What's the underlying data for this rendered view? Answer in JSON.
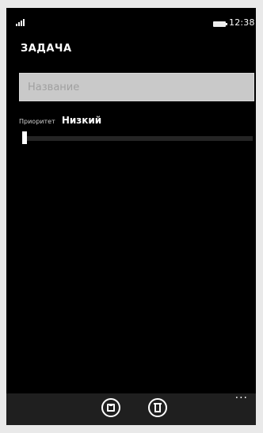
{
  "status_bar": {
    "time": "12:38",
    "signal_icon": "signal-icon",
    "battery_icon": "battery-icon"
  },
  "page": {
    "title": "ЗАДАЧА"
  },
  "form": {
    "name_value": "",
    "name_placeholder": "Название",
    "priority_label": "Приоритет",
    "priority_value": "Низкий",
    "priority_level": 0.0
  },
  "app_bar": {
    "buttons": [
      {
        "icon": "save-icon"
      },
      {
        "icon": "delete-icon"
      }
    ],
    "more_label": "···"
  },
  "colors": {
    "background": "#000000",
    "foreground": "#ffffff",
    "input_bg": "#c9c9c9",
    "app_bar_bg": "#1f1f1f"
  }
}
